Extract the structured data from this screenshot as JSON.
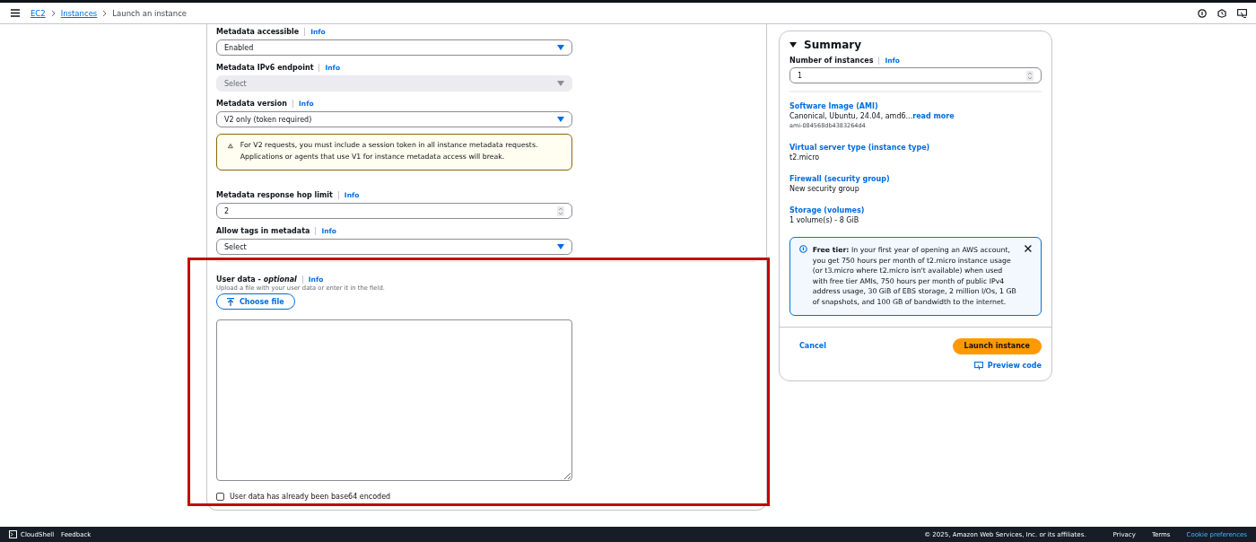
{
  "header": {
    "breadcrumb": [
      {
        "label": "EC2",
        "link": true
      },
      {
        "label": "Instances",
        "link": true
      },
      {
        "label": "Launch an instance",
        "link": false
      }
    ]
  },
  "form": {
    "fields": [
      {
        "kind": "select",
        "label": "Metadata accessible",
        "info": "Info",
        "value": "Enabled",
        "disabled": false
      },
      {
        "kind": "select",
        "label": "Metadata IPv6 endpoint",
        "info": "Info",
        "placeholder": "Select",
        "disabled": true
      },
      {
        "kind": "select",
        "label": "Metadata version",
        "info": "Info",
        "value": "V2 only (token required)",
        "disabled": false
      },
      {
        "kind": "alert",
        "text": "For V2 requests, you must include a session token in all instance metadata requests. Applications or agents that use V1 for instance metadata access will break."
      },
      {
        "kind": "number",
        "label": "Metadata response hop limit",
        "info": "Info",
        "value": "2",
        "disabled": false
      },
      {
        "kind": "select",
        "label": "Allow tags in metadata",
        "info": "Info",
        "value": "Select",
        "disabled": false
      }
    ],
    "user_data": {
      "label": "User data - *optional*",
      "info": "Info",
      "hint": "Upload a file with your user data or enter it in the field.",
      "button": "Choose file",
      "checkbox": {
        "label": "User data has already been base64 encoded",
        "checked": false
      }
    }
  },
  "summary": {
    "title": "Summary",
    "expanded": true,
    "instances": {
      "label": "Number of instances",
      "info": "Info",
      "value": "1"
    },
    "items": [
      {
        "heading": "Software Image (AMI)",
        "value": "Canonical, Ubuntu, 24.04, amd6...",
        "link": "read more",
        "sub": "ami-084568db4383264d4"
      },
      {
        "heading": "Virtual server type (instance type)",
        "value": "t2.micro"
      },
      {
        "heading": "Firewall (security group)",
        "value": "New security group"
      },
      {
        "heading": "Storage (volumes)",
        "value": "1 volume(s) - 8 GiB"
      }
    ],
    "notice": "**Free tier:** In your first year of opening an AWS account, you get 750 hours per month of t2.micro instance usage (or t3.micro where t2.micro isn't available) when used with free tier AMIs, 750 hours per month of public IPv4 address usage, 30 GiB of EBS storage, 2 million I/Os, 1 GB of snapshots, and 100 GB of bandwidth to the internet.",
    "cancel": "Cancel",
    "launch": "Launch instance",
    "preview": "Preview code"
  },
  "footer": {
    "left": [
      "CloudShell",
      "Feedback"
    ],
    "copyright": "© 2025, Amazon Web Services, Inc. or its affiliates.",
    "links": [
      "Privacy",
      "Terms",
      "Cookie preferences"
    ]
  }
}
